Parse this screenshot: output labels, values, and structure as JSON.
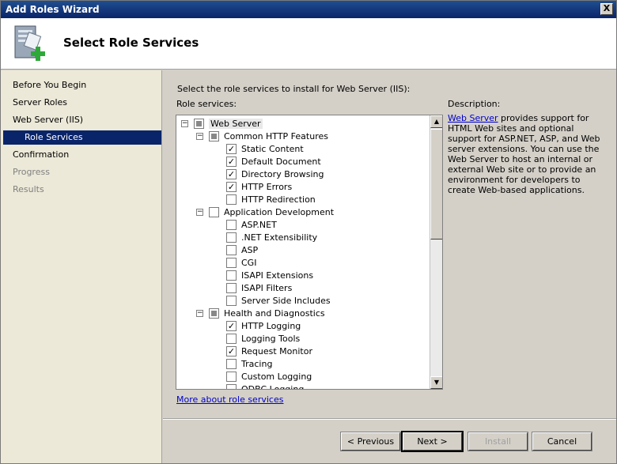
{
  "window": {
    "title": "Add Roles Wizard",
    "close_label": "X"
  },
  "header": {
    "title": "Select Role Services"
  },
  "sidebar": {
    "items": [
      {
        "label": "Before You Begin",
        "state": "normal"
      },
      {
        "label": "Server Roles",
        "state": "normal"
      },
      {
        "label": "Web Server (IIS)",
        "state": "normal"
      },
      {
        "label": "Role Services",
        "state": "active"
      },
      {
        "label": "Confirmation",
        "state": "normal"
      },
      {
        "label": "Progress",
        "state": "disabled"
      },
      {
        "label": "Results",
        "state": "disabled"
      }
    ]
  },
  "main": {
    "instruction": "Select the role services to install for Web Server (IIS):",
    "role_services_label": "Role services:",
    "description_label": "Description:",
    "description_link": "Web Server",
    "description_text": " provides support for HTML Web sites and optional support for ASP.NET, ASP, and Web server extensions. You can use the Web Server to host an internal or external Web site or to provide an environment for developers to create Web-based applications.",
    "more_link": "More about role services",
    "tree": [
      {
        "label": "Web Server",
        "level": 0,
        "expander": "-",
        "check": "partial"
      },
      {
        "label": "Common HTTP Features",
        "level": 1,
        "expander": "-",
        "check": "partial"
      },
      {
        "label": "Static Content",
        "level": 2,
        "check": "checked"
      },
      {
        "label": "Default Document",
        "level": 2,
        "check": "checked"
      },
      {
        "label": "Directory Browsing",
        "level": 2,
        "check": "checked"
      },
      {
        "label": "HTTP Errors",
        "level": 2,
        "check": "checked"
      },
      {
        "label": "HTTP Redirection",
        "level": 2,
        "check": "unchecked"
      },
      {
        "label": "Application Development",
        "level": 1,
        "expander": "-",
        "check": "unchecked"
      },
      {
        "label": "ASP.NET",
        "level": 2,
        "check": "unchecked"
      },
      {
        "label": ".NET Extensibility",
        "level": 2,
        "check": "unchecked"
      },
      {
        "label": "ASP",
        "level": 2,
        "check": "unchecked"
      },
      {
        "label": "CGI",
        "level": 2,
        "check": "unchecked"
      },
      {
        "label": "ISAPI Extensions",
        "level": 2,
        "check": "unchecked"
      },
      {
        "label": "ISAPI Filters",
        "level": 2,
        "check": "unchecked"
      },
      {
        "label": "Server Side Includes",
        "level": 2,
        "check": "unchecked"
      },
      {
        "label": "Health and Diagnostics",
        "level": 1,
        "expander": "-",
        "check": "partial"
      },
      {
        "label": "HTTP Logging",
        "level": 2,
        "check": "checked"
      },
      {
        "label": "Logging Tools",
        "level": 2,
        "check": "unchecked"
      },
      {
        "label": "Request Monitor",
        "level": 2,
        "check": "checked"
      },
      {
        "label": "Tracing",
        "level": 2,
        "check": "unchecked"
      },
      {
        "label": "Custom Logging",
        "level": 2,
        "check": "unchecked"
      },
      {
        "label": "ODBC Logging",
        "level": 2,
        "check": "unchecked"
      }
    ]
  },
  "buttons": {
    "previous": "< Previous",
    "next": "Next >",
    "install": "Install",
    "cancel": "Cancel"
  },
  "colors": {
    "accent": "#0a246a",
    "link": "#0000cc"
  }
}
